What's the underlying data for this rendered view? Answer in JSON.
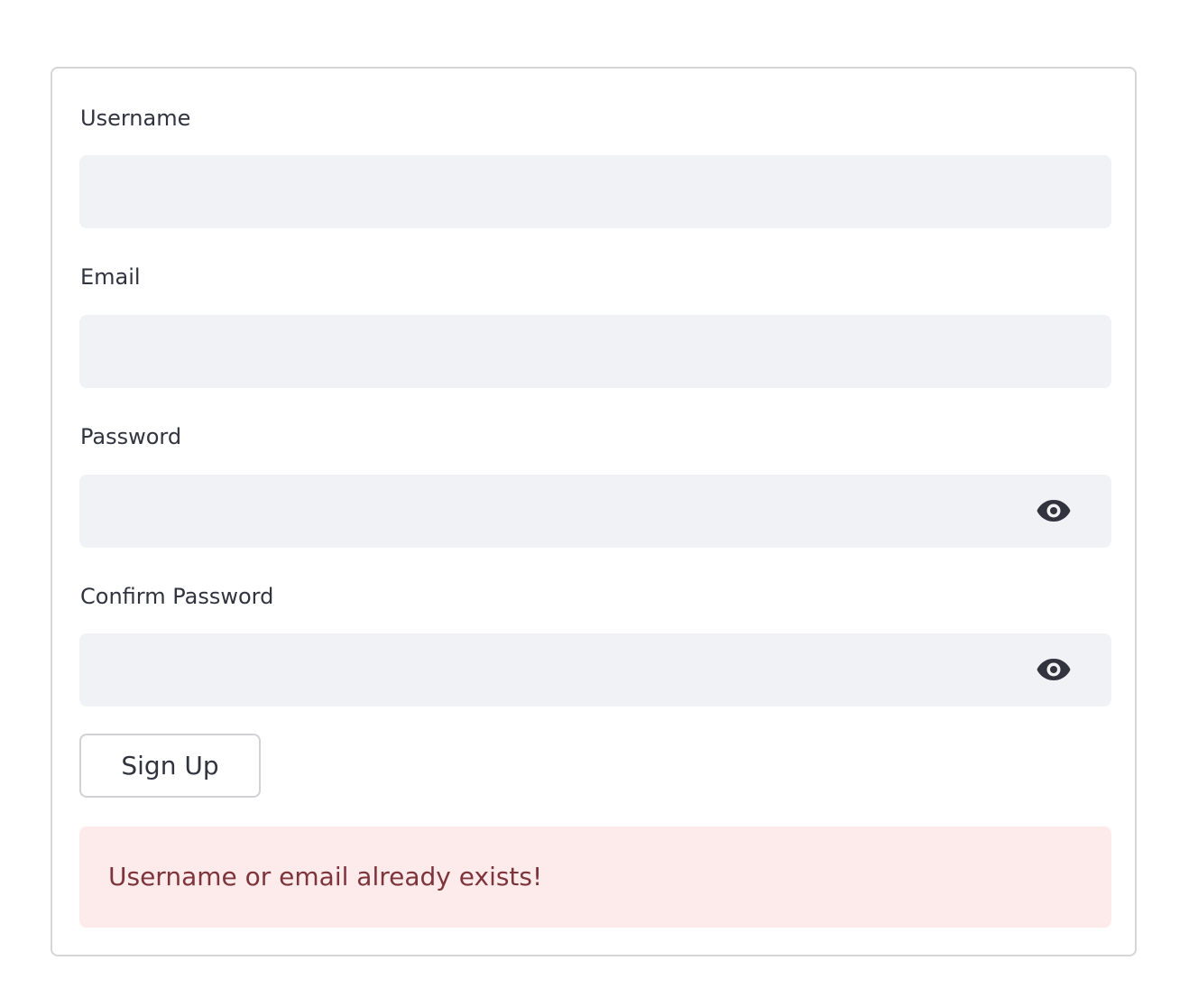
{
  "form": {
    "fields": [
      {
        "label": "Username",
        "value": "",
        "type": "text"
      },
      {
        "label": "Email",
        "value": "",
        "type": "text"
      },
      {
        "label": "Password",
        "value": "",
        "type": "password",
        "toggle_icon": "eye-icon"
      },
      {
        "label": "Confirm Password",
        "value": "",
        "type": "password",
        "toggle_icon": "eye-icon"
      }
    ],
    "submit_label": "Sign Up",
    "error_message": "Username or email already exists!"
  },
  "colors": {
    "input_background": "#f0f2f6",
    "error_background": "#fdebec",
    "error_text": "#7d353b",
    "text": "#31333f",
    "border": "#d6d6d9"
  }
}
